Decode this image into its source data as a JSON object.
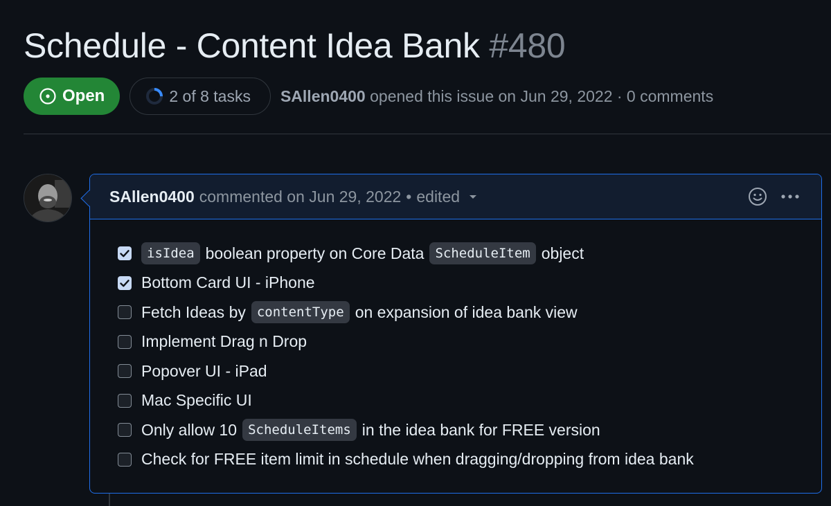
{
  "issue": {
    "title": "Schedule - Content Idea Bank",
    "number": "#480",
    "state": "Open",
    "tasks_summary": "2 of 8 tasks",
    "tasks_done": 2,
    "tasks_total": 8,
    "author": "SAllen0400",
    "opened_text": "opened this issue on Jun 29, 2022 · 0 comments"
  },
  "comment": {
    "author": "SAllen0400",
    "commented_text": "commented on Jun 29, 2022",
    "separator": "•",
    "edited_label": "edited",
    "tasks": [
      {
        "checked": true,
        "code_lead": "isIdea",
        "mid": "boolean property on Core Data",
        "code_mid": "ScheduleItem",
        "after": "object"
      },
      {
        "checked": true,
        "text": "Bottom Card UI - iPhone"
      },
      {
        "checked": false,
        "before": "Fetch Ideas by",
        "code_mid": "contentType",
        "after": "on expansion of idea bank view"
      },
      {
        "checked": false,
        "text": "Implement Drag n Drop"
      },
      {
        "checked": false,
        "text": "Popover UI - iPad"
      },
      {
        "checked": false,
        "text": "Mac Specific UI"
      },
      {
        "checked": false,
        "before": "Only allow 10",
        "code_mid": "ScheduleItems",
        "after": "in the idea bank for FREE version"
      },
      {
        "checked": false,
        "text": "Check for FREE item limit in schedule when dragging/dropping from idea bank"
      }
    ]
  },
  "colors": {
    "background": "#0d1117",
    "open_green": "#238636",
    "accent_blue": "#1f6feb",
    "border": "#30363d",
    "muted": "#8d96a0"
  }
}
